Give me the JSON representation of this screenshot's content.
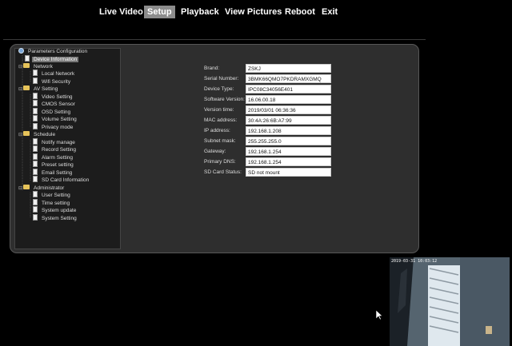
{
  "nav": {
    "items": [
      "Live Video",
      "Setup",
      "Playback",
      "View Pictures",
      "Reboot",
      "Exit"
    ],
    "active": "Setup"
  },
  "tree": {
    "root": "Parameters Configuration",
    "device_information": "Device Information",
    "network": {
      "label": "Network",
      "items": [
        "Local Network",
        "Wifi Security"
      ]
    },
    "av_setting": {
      "label": "AV Setting",
      "items": [
        "Video Setting",
        "CMOS Sensor",
        "OSD Setting",
        "Volume Setting",
        "Privacy mode"
      ]
    },
    "schedule": {
      "label": "Schedule",
      "items": [
        "Notify manage",
        "Record Setting",
        "Alarm Setting",
        "Preset setting",
        "Email Setting",
        "SD Card Information"
      ]
    },
    "administrator": {
      "label": "Administrator",
      "items": [
        "User Setting",
        "Time setting",
        "System update",
        "System Setting"
      ]
    }
  },
  "device_info": [
    {
      "label": "Brand:",
      "value": "ZSKJ"
    },
    {
      "label": "Serial Number:",
      "value": "3BMK66QMO7PKDRAMXGMQ"
    },
    {
      "label": "Device Type:",
      "value": "IPC08C34056E401"
    },
    {
      "label": "Software Version:",
      "value": "16.06.00.18"
    },
    {
      "label": "Version time:",
      "value": "2019/03/01 06:36:36"
    },
    {
      "label": "MAC address:",
      "value": "30:4A:26:6B:A7:99"
    },
    {
      "label": "IP address:",
      "value": "192.168.1.208"
    },
    {
      "label": "Subnet mask:",
      "value": "255.255.255.0"
    },
    {
      "label": "Gateway:",
      "value": "192.168.1.254"
    },
    {
      "label": "Primary DNS:",
      "value": "192.168.1.254"
    },
    {
      "label": "SD Card Status:",
      "value": "SD not mount"
    }
  ],
  "preview": {
    "timestamp": "2019-03-31 10:03:12"
  }
}
